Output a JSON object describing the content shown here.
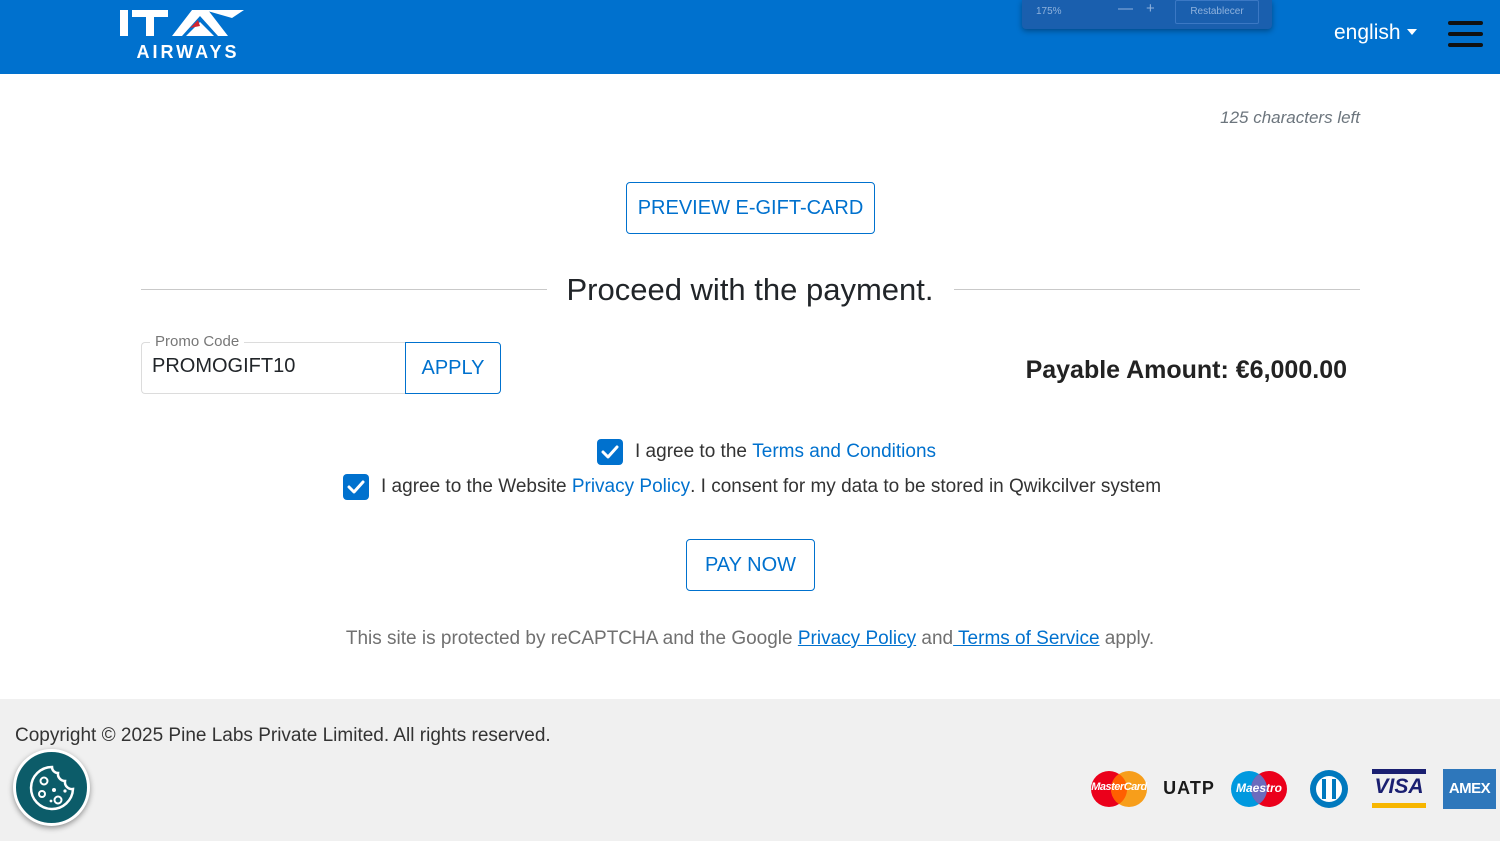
{
  "header": {
    "logo_text": "AIRWAYS",
    "zoom": {
      "level": "175%",
      "minus": "—",
      "plus": "+",
      "reset_label": "Restablecer"
    },
    "language": "english"
  },
  "main": {
    "chars_left": "125 characters left",
    "preview_button": "PREVIEW E-GIFT-CARD",
    "section_title": "Proceed with the payment.",
    "promo": {
      "label": "Promo Code",
      "value": "PROMOGIFT10",
      "apply_label": "APPLY"
    },
    "payable_amount": "Payable Amount: €6,000.00",
    "terms": {
      "prefix": "I agree to the ",
      "link": "Terms and Conditions",
      "checked": true
    },
    "privacy": {
      "prefix": "I agree to the Website ",
      "link": "Privacy Policy",
      "suffix": ". I consent for my data to be stored in Qwikcilver system",
      "checked": true
    },
    "pay_button": "PAY NOW",
    "recaptcha": {
      "prefix": "This site is protected by reCAPTCHA and the Google ",
      "privacy_link": "Privacy Policy",
      "and": " and",
      "terms_link": " Terms of Service",
      "suffix": " apply."
    }
  },
  "footer": {
    "copyright": "Copyright © 2025 Pine Labs Private Limited. All rights reserved.",
    "payment_logos": {
      "mastercard": "MasterCard",
      "uatp": "UATP",
      "maestro": "Maestro",
      "visa": "VISA",
      "amex": "AMEX"
    }
  },
  "colors": {
    "brand_blue": "#0071ce",
    "footer_bg": "#f0f0f0",
    "cookie_teal": "#0c5c69"
  }
}
